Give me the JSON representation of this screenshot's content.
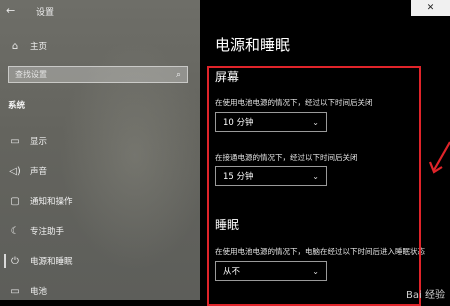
{
  "window": {
    "title": "设置",
    "close_symbol": "✕"
  },
  "sidebar": {
    "back_symbol": "←",
    "home_label": "主页",
    "search_placeholder": "查找设置",
    "section_title": "系统",
    "items": [
      {
        "label": "显示",
        "icon": "display-icon"
      },
      {
        "label": "声音",
        "icon": "speaker-icon"
      },
      {
        "label": "通知和操作",
        "icon": "notification-icon"
      },
      {
        "label": "专注助手",
        "icon": "focus-assist-icon"
      },
      {
        "label": "电源和睡眠",
        "icon": "power-icon",
        "selected": true
      },
      {
        "label": "电池",
        "icon": "battery-icon"
      }
    ]
  },
  "main": {
    "page_title": "电源和睡眠",
    "screen": {
      "heading": "屏幕",
      "battery_label": "在使用电池电源的情况下，经过以下时间后关闭",
      "battery_value": "10 分钟",
      "plugged_label": "在接通电源的情况下，经过以下时间后关闭",
      "plugged_value": "15 分钟"
    },
    "sleep": {
      "heading": "睡眠",
      "battery_label": "在使用电池电源的情况下，电脑在经过以下时间后进入睡眠状态",
      "battery_value": "从不"
    }
  },
  "annotation": {
    "highlight_color": "#e0242a"
  },
  "watermark": "Bai 经验"
}
